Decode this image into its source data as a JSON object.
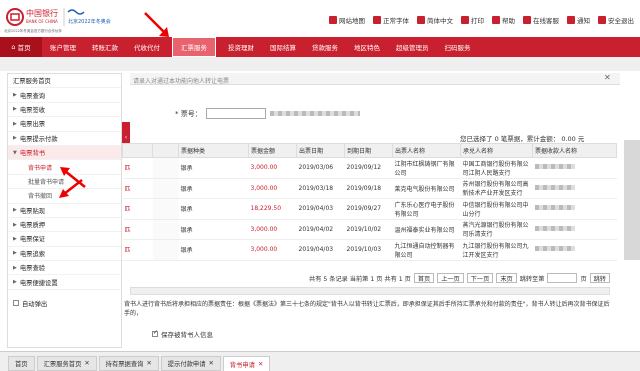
{
  "header": {
    "bank": "中国银行",
    "bank_en": "BANK OF CHINA",
    "olympic": "北京2022年冬奥会",
    "slogan": "北京2022年冬奥会官方银行合作伙伴"
  },
  "toplinks": [
    "网站地图",
    "正常字体",
    "简体中文",
    "打印",
    "帮助",
    "在线客服",
    "通知",
    "安全退出"
  ],
  "nav": {
    "home": "首页",
    "items": [
      "账户管理",
      "转账汇款",
      "代收代付",
      "汇票服务",
      "投资理财",
      "国际结算",
      "贷款服务",
      "地区特色",
      "超级管理员",
      "扫码服务"
    ]
  },
  "sidebar": {
    "items": [
      "汇票服务首页",
      "电票查询",
      "电票签收",
      "电票出票",
      "电票提示付款",
      "电票背书",
      "背书申请",
      "批量背书申请",
      "背书撤回",
      "电票贴现",
      "电票质押",
      "电票保证",
      "电票追索",
      "电票查验",
      "电票便捷设置"
    ],
    "auto_popup": "自动弹出"
  },
  "notice": "请录入对通过本功能向他人转让电票",
  "bill_label": "* 票号：",
  "stats": "您已选择了 0 笔票据，累计金额： 0.00 元",
  "table": {
    "headers": [
      "票据种类",
      "票据金额",
      "出票日期",
      "到期日期",
      "出票人名称",
      "承兑人名称",
      "票据收款人名称"
    ],
    "rows": [
      [
        "银承",
        "3,000.00",
        "2019/03/06",
        "2019/09/12",
        "江阴市红枫铸钢厂有限公司",
        "中国工商银行股份有限公司江阴人民路支行",
        ""
      ],
      [
        "银承",
        "3,000.00",
        "2019/03/18",
        "2019/09/18",
        "莱克电气股份有限公司",
        "苏州银行股份有限公司高新技术产业开发区支行",
        ""
      ],
      [
        "银承",
        "18,229.50",
        "2019/04/03",
        "2019/09/27",
        "广东乐心医疗电子股份有限公司",
        "中信银行股份有限公司中山分行",
        ""
      ],
      [
        "银承",
        "3,000.00",
        "2019/04/02",
        "2019/10/02",
        "温州福泰实业有限公司",
        "蒸汽光源银行股份有限公司乐清支行",
        ""
      ],
      [
        "银承",
        "3,000.00",
        "2019/04/03",
        "2019/10/03",
        "九江恒通自动控制器有限公司",
        "九江银行股份有限公司九江开发区支行",
        ""
      ]
    ]
  },
  "pager": {
    "text": "共有 5 条记录 当前第 1 页 共有 1 页",
    "buttons": [
      "首页",
      "上一页",
      "下一页",
      "末页"
    ],
    "goto": "跳转至第",
    "page": "页",
    "go": "跳转"
  },
  "info": "背书人进行背书后将承担相应的票据责任：根据《票据法》第三十七条的规定\"背书人以背书转让汇票后，即承担保证其后手所持汇票承兑和付款的责任\"，背书人转让后再次背书保证后手的，",
  "checkbox_label": "保存被背书人信息",
  "taskbar": [
    "首页",
    "汇票服务首页",
    "持有票据查询",
    "提示付款申请",
    "背书申请"
  ]
}
